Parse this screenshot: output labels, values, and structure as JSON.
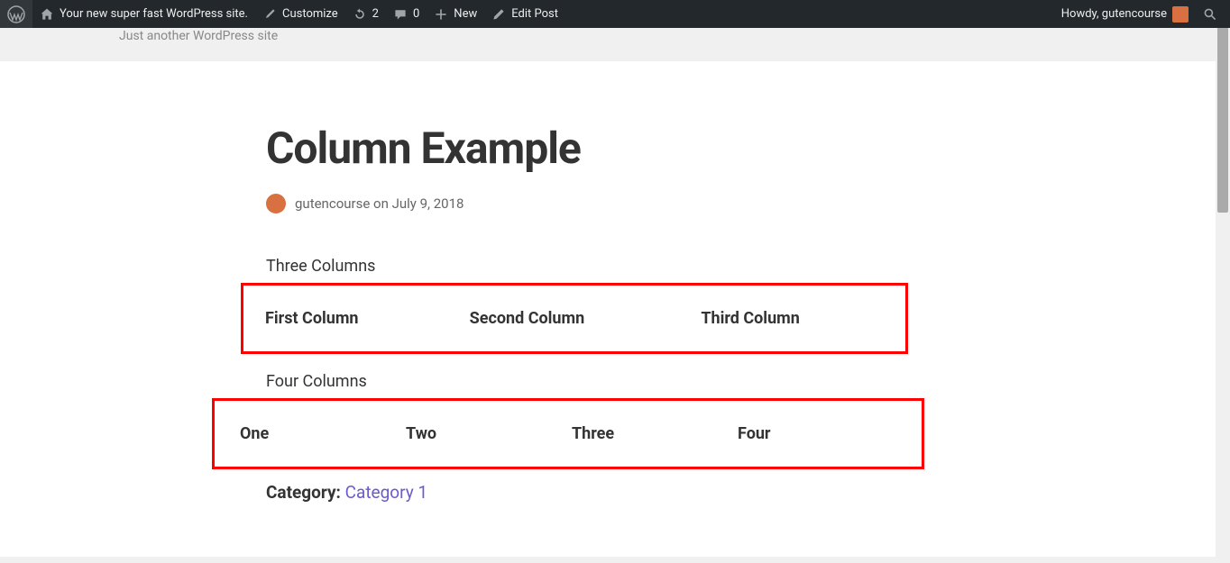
{
  "admin_bar": {
    "site_name": "Your new super fast WordPress site.",
    "customize": "Customize",
    "updates_count": "2",
    "comments_count": "0",
    "new": "New",
    "edit_post": "Edit Post",
    "howdy": "Howdy, gutencourse"
  },
  "tagline": "Just another WordPress site",
  "post": {
    "title": "Column Example",
    "author": "gutencourse",
    "date_prefix": "on",
    "date": "July 9, 2018",
    "three_label": "Three Columns",
    "three_cols": {
      "c1": "First Column",
      "c2": "Second Column",
      "c3": "Third Column"
    },
    "four_label": "Four Columns",
    "four_cols": {
      "c1": "One",
      "c2": "Two",
      "c3": "Three",
      "c4": "Four"
    },
    "category_label": "Category:",
    "category_value": "Category 1"
  }
}
